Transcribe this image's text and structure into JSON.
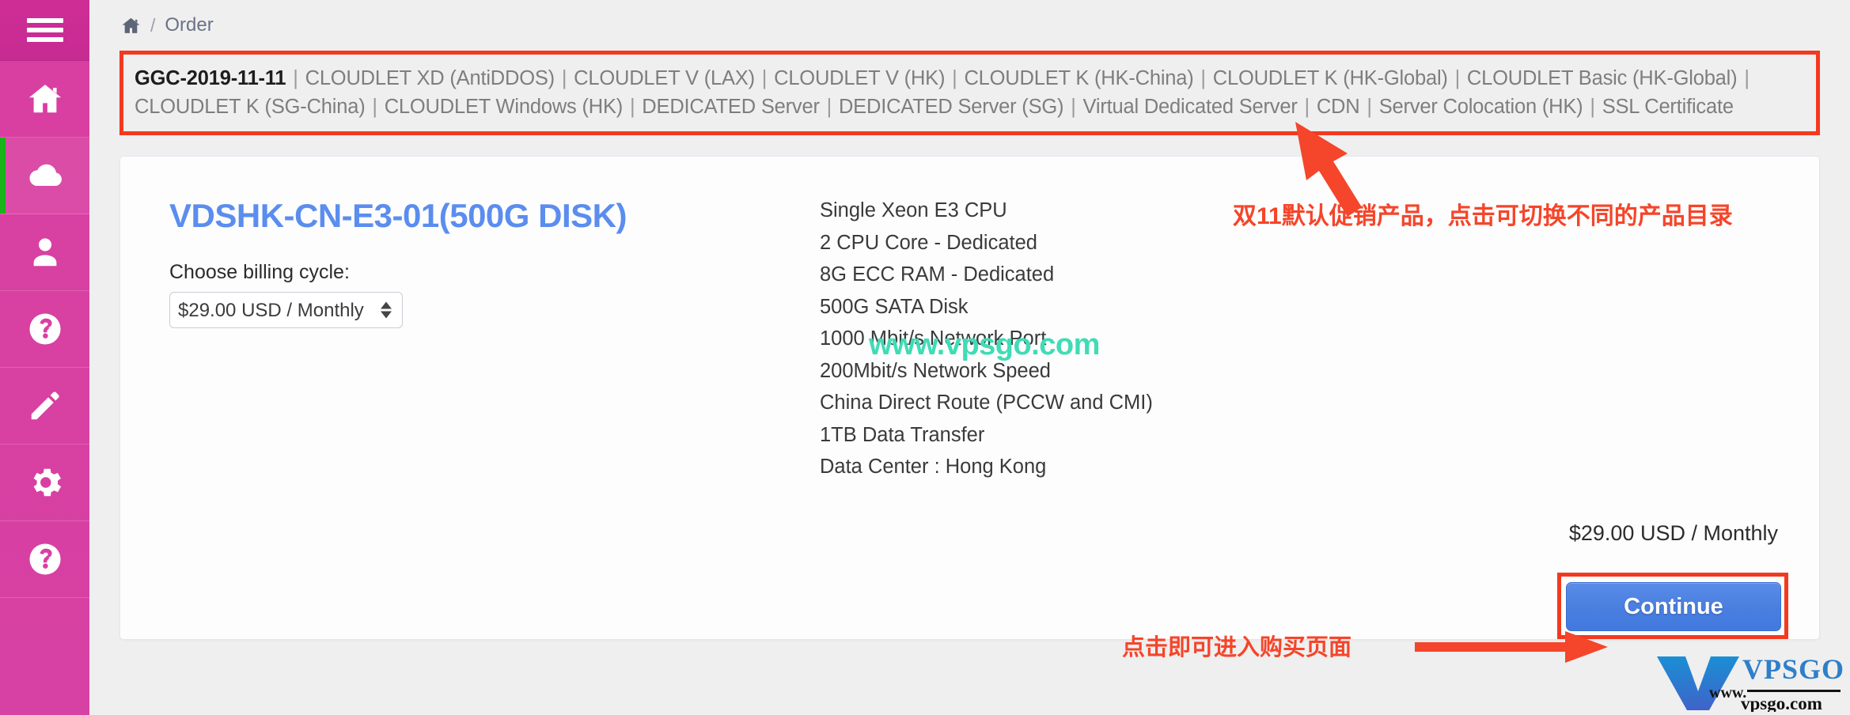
{
  "sidebar": {
    "items": [
      {
        "name": "menu-toggle",
        "icon": "hamburger-icon",
        "active": false
      },
      {
        "name": "home",
        "icon": "home-icon",
        "active": false
      },
      {
        "name": "cloud-services",
        "icon": "cloud-icon",
        "active": true
      },
      {
        "name": "account",
        "icon": "user-icon",
        "active": false
      },
      {
        "name": "support",
        "icon": "question-circle-icon",
        "active": false
      },
      {
        "name": "edit",
        "icon": "pencil-icon",
        "active": false
      },
      {
        "name": "settings",
        "icon": "gear-icon",
        "active": false
      },
      {
        "name": "help",
        "icon": "question-circle-icon",
        "active": false
      },
      {
        "name": "blank",
        "icon": "",
        "active": false
      }
    ]
  },
  "breadcrumb": {
    "home_icon": "home-icon",
    "separator": "/",
    "current": "Order"
  },
  "product_categories": {
    "items": [
      {
        "label": "GGC-2019-11-11",
        "selected": true
      },
      {
        "label": "CLOUDLET XD (AntiDDOS)",
        "selected": false
      },
      {
        "label": "CLOUDLET V (LAX)",
        "selected": false
      },
      {
        "label": "CLOUDLET V (HK)",
        "selected": false
      },
      {
        "label": "CLOUDLET K (HK-China)",
        "selected": false
      },
      {
        "label": "CLOUDLET K (HK-Global)",
        "selected": false
      },
      {
        "label": "CLOUDLET Basic (HK-Global)",
        "selected": false
      },
      {
        "label": "CLOUDLET K (SG-China)",
        "selected": false
      },
      {
        "label": "CLOUDLET Windows (HK)",
        "selected": false
      },
      {
        "label": "DEDICATED Server",
        "selected": false
      },
      {
        "label": "DEDICATED Server (SG)",
        "selected": false
      },
      {
        "label": "Virtual Dedicated Server",
        "selected": false
      },
      {
        "label": "CDN",
        "selected": false
      },
      {
        "label": "Server Colocation (HK)",
        "selected": false
      },
      {
        "label": "SSL Certificate",
        "selected": false
      }
    ],
    "separator": "|",
    "highlight_color": "#f3391f"
  },
  "order_card": {
    "product_title": "VDSHK-CN-E3-01(500G DISK)",
    "title_color": "#5b8def",
    "billing_label": "Choose billing cycle:",
    "billing_selected": "$29.00 USD / Monthly",
    "billing_options": [
      "$29.00 USD / Monthly"
    ],
    "specs": [
      "Single Xeon E3 CPU",
      "2 CPU Core - Dedicated",
      "8G ECC RAM - Dedicated",
      "500G SATA Disk",
      "1000 Mbit/s Network Port",
      "200Mbit/s  Network Speed",
      "China Direct Route (PCCW and CMI)",
      "1TB Data Transfer",
      "Data Center : Hong Kong"
    ],
    "price_summary": "$29.00 USD / Monthly",
    "continue_label": "Continue",
    "continue_color": "#4a7fe0"
  },
  "annotations": {
    "top": "双11默认促销产品，点击可切换不同的产品目录",
    "bottom": "点击即可进入购买页面",
    "color": "#f5452a"
  },
  "watermarks": {
    "center_text": "www.vpsgo.com",
    "center_color": "#3fdcb6",
    "logo_brand": "VPSGO",
    "logo_www": "www.",
    "logo_domain": "vpsgo.com"
  }
}
